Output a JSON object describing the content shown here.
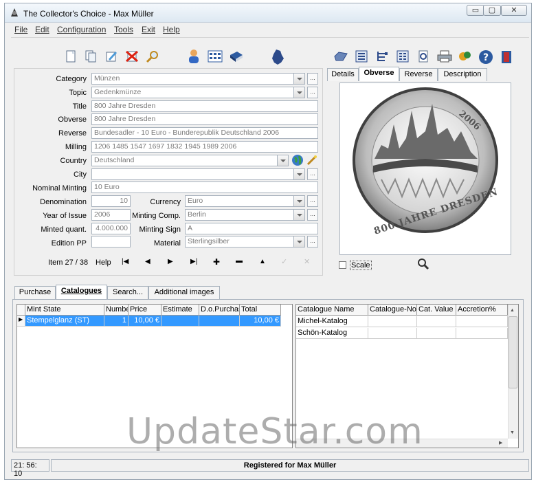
{
  "window": {
    "title": "The Collector's Choice - Max Müller"
  },
  "window_buttons": {
    "minimize": "▭",
    "maximize": "▢",
    "close": "✕"
  },
  "menu": [
    "File",
    "Edit",
    "Configuration",
    "Tools",
    "Exit",
    "Help"
  ],
  "form": {
    "category": {
      "label": "Category",
      "value": "Münzen"
    },
    "topic": {
      "label": "Topic",
      "value": "Gedenkmünze"
    },
    "title": {
      "label": "Title",
      "value": "800 Jahre Dresden"
    },
    "obverse": {
      "label": "Obverse",
      "value": "800 Jahre Dresden"
    },
    "reverse": {
      "label": "Reverse",
      "value": "Bundesadler - 10 Euro - Bunderepublik Deutschland 2006"
    },
    "milling": {
      "label": "Milling",
      "value": "1206 1485 1547 1697 1832 1945 1989 2006"
    },
    "country": {
      "label": "Country",
      "value": "Deutschland"
    },
    "city": {
      "label": "City",
      "value": ""
    },
    "nominal_minting": {
      "label": "Nominal Minting",
      "value": "10 Euro"
    },
    "denomination": {
      "label": "Denomination",
      "value": "10"
    },
    "currency": {
      "label": "Currency",
      "value": "Euro"
    },
    "year_of_issue": {
      "label": "Year of Issue",
      "value": "2006"
    },
    "minting_comp": {
      "label": "Minting Comp.",
      "value": "Berlin"
    },
    "minted_quant": {
      "label": "Minted quant.",
      "value": "4.000.000"
    },
    "minting_sign": {
      "label": "Minting Sign",
      "value": "A"
    },
    "edition_pp": {
      "label": "Edition PP",
      "value": ""
    },
    "material": {
      "label": "Material",
      "value": "Sterlingsilber"
    },
    "dots": "..."
  },
  "nav": {
    "item_text": "Item 27 / 38",
    "help": "Help",
    "first": "|◀",
    "prev": "◀",
    "next": "▶",
    "last": "▶|",
    "add": "✚",
    "remove": "▬",
    "up": "▲",
    "confirm": "✓",
    "cancel": "✕"
  },
  "image_tabs": [
    "Details",
    "Obverse",
    "Reverse",
    "Description"
  ],
  "image_panel": {
    "scale_label": "Scale",
    "coin_year": "2006",
    "coin_text": "800 JAHRE DRESDEN"
  },
  "bottom_tabs": [
    "Purchase",
    "Catalogues",
    "Search...",
    "Additional images"
  ],
  "left_table": {
    "columns": [
      "Mint State",
      "Numbe",
      "Price",
      "Estimate",
      "D.o.Purchas",
      "Total"
    ],
    "rows": [
      [
        "Stempelglanz (ST)",
        "1",
        "10,00 €",
        "",
        "",
        "10,00 €"
      ]
    ]
  },
  "right_table": {
    "columns": [
      "Catalogue Name",
      "Catalogue-No.",
      "Cat. Value",
      "Accretion%"
    ],
    "rows": [
      [
        "Michel-Katalog",
        "",
        "",
        ""
      ],
      [
        "Schön-Katalog",
        "",
        "",
        ""
      ]
    ]
  },
  "status": {
    "time": "21: 56: 10",
    "registered": "Registered for Max Müller"
  },
  "watermark": "UpdateStar.com",
  "colors": {
    "selection": "#3399ff",
    "title_gradient_top": "#f4f8fc"
  }
}
